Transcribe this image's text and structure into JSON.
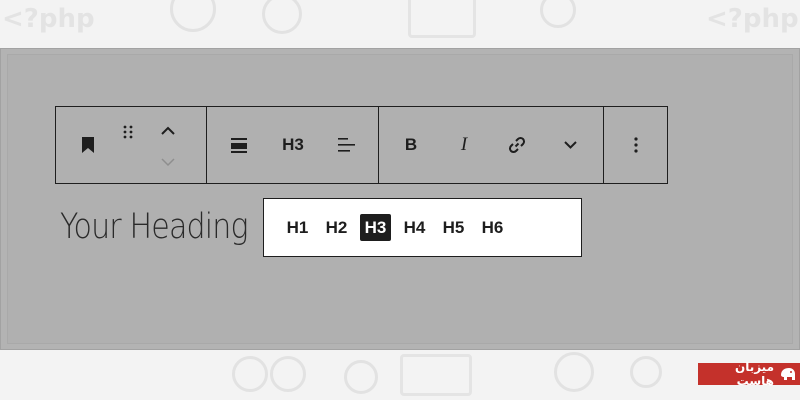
{
  "background": {
    "doodle_left": "<?php",
    "doodle_right": "<?php"
  },
  "toolbar": {
    "bookmark_icon": "bookmark-icon",
    "drag_icon": "drag-handle-icon",
    "move_up_icon": "chevron-up-icon",
    "move_down_icon": "chevron-down-icon",
    "align_icon": "align-wide-icon",
    "heading_level_label": "H3",
    "text_align_icon": "text-align-left-icon",
    "bold_label": "B",
    "italic_label": "I",
    "link_icon": "link-icon",
    "more_format_icon": "chevron-down-icon",
    "options_icon": "vertical-ellipsis-icon"
  },
  "editor": {
    "heading_text": "Your Heading"
  },
  "heading_levels": {
    "items": [
      {
        "label": "H1",
        "active": false
      },
      {
        "label": "H2",
        "active": false
      },
      {
        "label": "H3",
        "active": true
      },
      {
        "label": "H4",
        "active": false
      },
      {
        "label": "H5",
        "active": false
      },
      {
        "label": "H6",
        "active": false
      }
    ]
  },
  "brand": {
    "text": "میزبان هاست",
    "accent_color": "#c4312b"
  }
}
